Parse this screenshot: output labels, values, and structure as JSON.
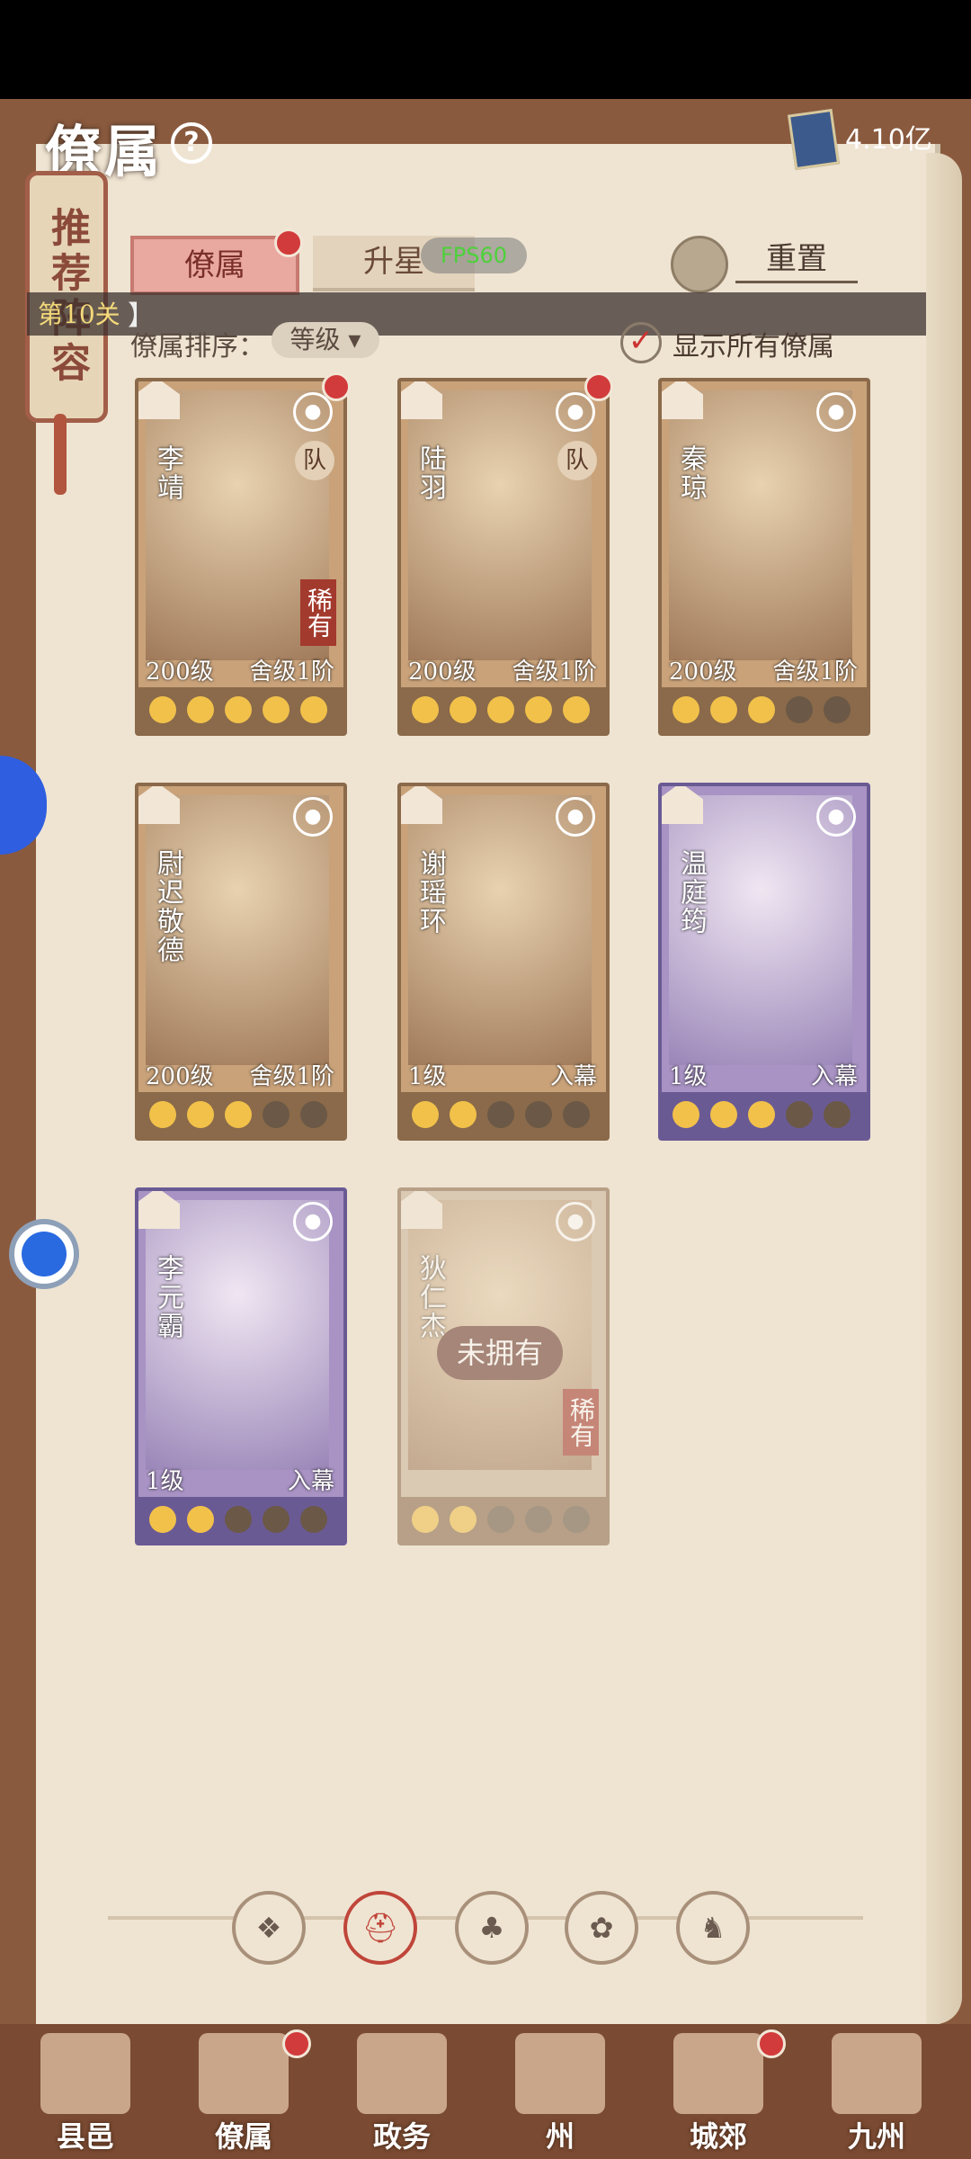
{
  "header": {
    "title": "僚属",
    "help_icon": "question-mark-icon",
    "currency_value": "4.10亿"
  },
  "tabs": [
    {
      "label": "僚属",
      "active": true
    },
    {
      "label": "升星",
      "active": false
    }
  ],
  "fps": "FPS60",
  "reset_label": "重置",
  "side_tag": "推荐阵容",
  "stage": "第10关",
  "stage_bracket": "】",
  "sort": {
    "label": "僚属排序：",
    "value": "等级"
  },
  "show_all": {
    "label": "显示所有僚属",
    "checked": true
  },
  "cards": [
    {
      "name": "李靖",
      "level": "200级",
      "rank": "舍级1阶",
      "rare": "稀有",
      "team": "队",
      "stars": 5,
      "purple": false,
      "owned": true,
      "reddot": true,
      "type_icon": "shield-icon"
    },
    {
      "name": "陆羽",
      "level": "200级",
      "rank": "舍级1阶",
      "rare": "",
      "team": "队",
      "stars": 5,
      "purple": false,
      "owned": true,
      "reddot": true,
      "type_icon": "gear-icon"
    },
    {
      "name": "秦琼",
      "level": "200级",
      "rank": "舍级1阶",
      "rare": "",
      "team": "",
      "stars": 3,
      "purple": false,
      "owned": true,
      "reddot": false,
      "type_icon": "sword-icon"
    },
    {
      "name": "尉迟敬德",
      "level": "200级",
      "rank": "舍级1阶",
      "rare": "",
      "team": "",
      "stars": 3,
      "purple": false,
      "owned": true,
      "reddot": false,
      "type_icon": "sword-icon"
    },
    {
      "name": "谢瑶环",
      "level": "1级",
      "rank": "入幕",
      "rare": "",
      "team": "",
      "stars": 2,
      "purple": false,
      "owned": true,
      "reddot": false,
      "type_icon": "sword-icon"
    },
    {
      "name": "温庭筠",
      "level": "1级",
      "rank": "入幕",
      "rare": "",
      "team": "",
      "stars": 3,
      "purple": true,
      "owned": true,
      "reddot": false,
      "type_icon": "yin-yang-icon"
    },
    {
      "name": "李元霸",
      "level": "1级",
      "rank": "入幕",
      "rare": "",
      "team": "",
      "stars": 2,
      "purple": true,
      "owned": true,
      "reddot": false,
      "type_icon": "shield-icon"
    },
    {
      "name": "狄仁杰",
      "level": "",
      "rank": "",
      "rare": "稀有",
      "team": "",
      "stars": 2,
      "purple": false,
      "owned": false,
      "unowned_label": "未拥有",
      "reddot": false,
      "type_icon": "yin-yang-icon"
    }
  ],
  "filters": [
    "grid-icon",
    "helmet-icon",
    "gourd-icon",
    "fan-icon",
    "horse-icon"
  ],
  "nav": [
    {
      "label": "县邑",
      "reddot": false
    },
    {
      "label": "僚属",
      "reddot": true,
      "active": true
    },
    {
      "label": "政务",
      "reddot": false
    },
    {
      "label": "州",
      "reddot": false
    },
    {
      "label": "城郊",
      "reddot": true
    },
    {
      "label": "九州",
      "reddot": false
    }
  ]
}
